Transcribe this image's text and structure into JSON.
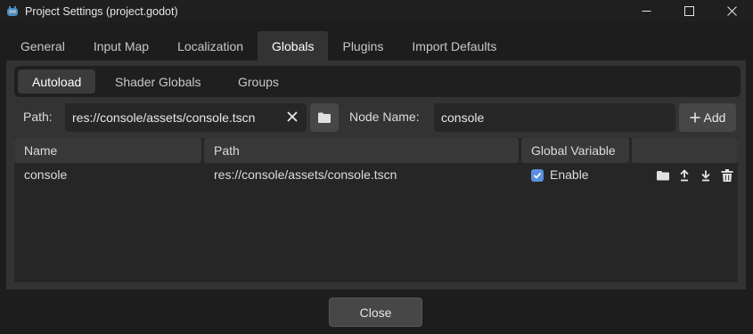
{
  "window": {
    "title": "Project Settings (project.godot)",
    "controls": {
      "minimize": "—",
      "maximize": "☐",
      "close": "✕"
    }
  },
  "tabs": [
    "General",
    "Input Map",
    "Localization",
    "Globals",
    "Plugins",
    "Import Defaults"
  ],
  "active_tab": "Globals",
  "subtabs": [
    "Autoload",
    "Shader Globals",
    "Groups"
  ],
  "active_subtab": "Autoload",
  "form": {
    "path_label": "Path:",
    "path_value": "res://console/assets/console.tscn",
    "node_name_label": "Node Name:",
    "node_name_value": "console",
    "add_label": "Add"
  },
  "table": {
    "columns": [
      "Name",
      "Path",
      "Global Variable",
      ""
    ],
    "rows": [
      {
        "name": "console",
        "path": "res://console/assets/console.tscn",
        "global_checked": true,
        "global_label": "Enable"
      }
    ]
  },
  "footer": {
    "close_label": "Close"
  },
  "colors": {
    "background": "#1d1d1d",
    "panel": "#333333",
    "field": "#262626",
    "button": "#474747",
    "accent_checkbox": "#5b8fe0",
    "godot_blue": "#478cbf"
  },
  "icons": [
    "godot-icon",
    "clear-icon",
    "folder-icon",
    "plus-icon",
    "check-icon",
    "folder-icon",
    "arrow-up-icon",
    "arrow-down-icon",
    "trash-icon"
  ]
}
